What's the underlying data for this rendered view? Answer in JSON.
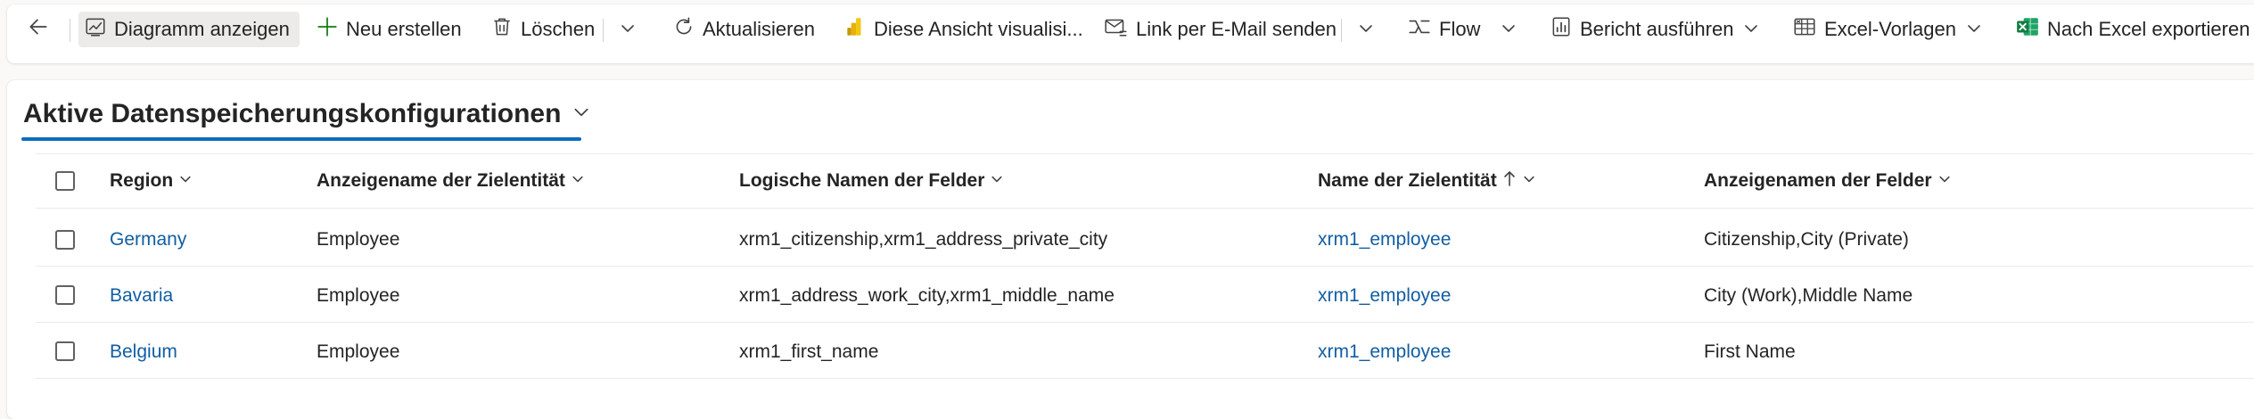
{
  "toolbar": {
    "back_icon": "arrow-left-icon",
    "commands": [
      {
        "label": "Diagramm anzeigen",
        "icon": "chart-icon"
      },
      {
        "label": "Neu erstellen",
        "icon": "plus-icon"
      },
      {
        "label": "Löschen",
        "icon": "trash-icon"
      },
      {
        "label": "Aktualisieren",
        "icon": "refresh-icon"
      },
      {
        "label": "Diese Ansicht visualisi...",
        "icon": "power-bi-icon"
      },
      {
        "label": "Link per E-Mail senden",
        "icon": "email-link-icon"
      },
      {
        "label": "Flow",
        "icon": "flow-icon"
      },
      {
        "label": "Bericht ausführen",
        "icon": "report-icon"
      },
      {
        "label": "Excel-Vorlagen",
        "icon": "excel-template-icon"
      },
      {
        "label": "Nach Excel exportieren",
        "icon": "excel-icon"
      }
    ]
  },
  "view": {
    "title": "Aktive Datenspeicherungskonfigurationen"
  },
  "grid": {
    "columns": [
      {
        "label": "Region",
        "sort": "none"
      },
      {
        "label": "Anzeigename der Zielentität",
        "sort": "none"
      },
      {
        "label": "Logische Namen der Felder",
        "sort": "none"
      },
      {
        "label": "Name der Zielentität",
        "sort": "ascending"
      },
      {
        "label": "Anzeigenamen der Felder",
        "sort": "none"
      }
    ],
    "rows": [
      {
        "region": "Germany",
        "entity_display": "Employee",
        "logical_names": "xrm1_citizenship,xrm1_address_private_city",
        "entity_name": "xrm1_employee",
        "display_names": "Citizenship,City (Private)"
      },
      {
        "region": "Bavaria",
        "entity_display": "Employee",
        "logical_names": "xrm1_address_work_city,xrm1_middle_name",
        "entity_name": "xrm1_employee",
        "display_names": "City (Work),Middle Name"
      },
      {
        "region": "Belgium",
        "entity_display": "Employee",
        "logical_names": "xrm1_first_name",
        "entity_name": "xrm1_employee",
        "display_names": "First Name"
      }
    ]
  },
  "colors": {
    "accent": "#0f6cbd",
    "link": "#115ea3",
    "text": "#242424",
    "excel_green": "#107c41",
    "power_bi_yellow": "#f2c811"
  }
}
